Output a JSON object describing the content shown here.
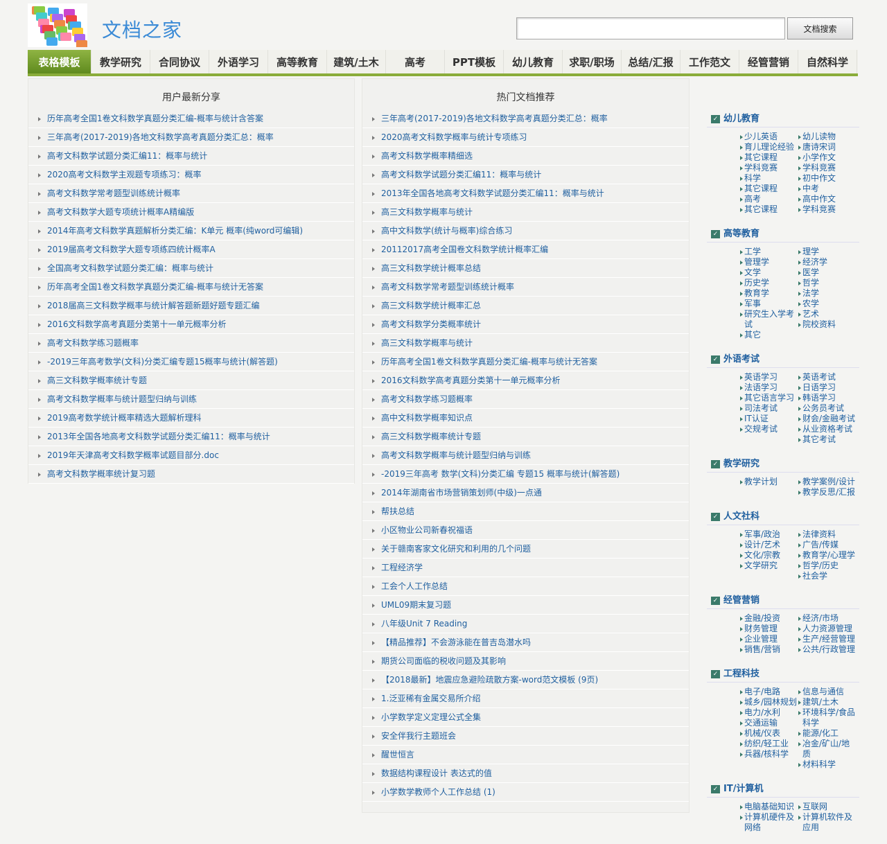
{
  "header": {
    "site_title": "文档之家",
    "search_placeholder": "",
    "search_button": "文档搜索"
  },
  "nav": [
    "表格模板",
    "教学研究",
    "合同协议",
    "外语学习",
    "高等教育",
    "建筑/土木",
    "高考",
    "PPT模板",
    "幼儿教育",
    "求职/职场",
    "总结/汇报",
    "工作范文",
    "经管营销",
    "自然科学"
  ],
  "latest": {
    "title": "用户最新分享",
    "items": [
      "历年高考全国1卷文科数学真题分类汇编-概率与统计含答案",
      "三年高考(2017-2019)各地文科数学高考真题分类汇总：概率",
      "高考文科数学试题分类汇编11：概率与统计",
      "2020高考文科数学主观题专项练习：概率",
      "高考文科数学常考题型训练统计概率",
      "高考文科数学大题专项统计概率A精编版",
      "2014年高考文科数学真题解析分类汇编：K单元 概率(纯word可编辑)",
      "2019届高考文科数学大题专项练四统计概率A",
      "全国高考文科数学试题分类汇编：概率与统计",
      "历年高考全国1卷文科数学真题分类汇编-概率与统计无答案",
      "2018届高三文科数学概率与统计解答题新题好题专题汇编",
      "2016文科数学高考真题分类第十一单元概率分析",
      "高考文科数学练习题概率",
      "-2019三年高考数学(文科)分类汇编专题15概率与统计(解答题)",
      "高三文科数学概率统计专题",
      "高考文科数学概率与统计题型归纳与训练",
      "2019高考数学统计概率精选大题解析理科",
      "2013年全国各地高考文科数学试题分类汇编11：概率与统计",
      "2019年天津高考文科数学概率试题目部分.doc",
      "高考文科数学概率统计复习题"
    ]
  },
  "hot": {
    "title": "热门文档推荐",
    "items": [
      "三年高考(2017-2019)各地文科数学高考真题分类汇总：概率",
      "2020高考文科数学概率与统计专项练习",
      "高考文科数学概率精细选",
      "高考文科数学试题分类汇编11：概率与统计",
      "2013年全国各地高考文科数学试题分类汇编11：概率与统计",
      "高三文科数学概率与统计",
      "高中文科数学(统计与概率)综合练习",
      "20112017高考全国卷文科数学统计概率汇编",
      "高三文科数学统计概率总结",
      "高考文科数学常考题型训练统计概率",
      "高三文科数学统计概率汇总",
      "高考文科数学分类概率统计",
      "高三文科数学概率与统计",
      "历年高考全国1卷文科数学真题分类汇编-概率与统计无答案",
      "2016文科数学高考真题分类第十一单元概率分析",
      "高考文科数学练习题概率",
      "高中文科数学概率知识点",
      "高三文科数学概率统计专题",
      "高考文科数学概率与统计题型归纳与训练",
      "-2019三年高考 数学(文科)分类汇编 专题15 概率与统计(解答题)",
      "2014年湖南省市场营销策划师(中级)一点通",
      "帮扶总结",
      "小区物业公司新春祝福语",
      "关于赣南客家文化研究和利用的几个问题",
      "工程经济学",
      "工会个人工作总结",
      "UML09期末复习题",
      "八年级Unit 7 Reading",
      "【精品推荐】不会游泳能在普吉岛潜水吗",
      "期货公司面临的税收问题及其影响",
      "【2018最新】地震应急避险疏散方案-word范文模板 (9页)",
      "1.泛亚稀有金属交易所介绍",
      "小学数学定义定理公式全集",
      "安全伴我行主题班会",
      "醒世恒言",
      "数据结构课程设计 表达式的值",
      "小学数学教师个人工作总结 (1)"
    ]
  },
  "sidebar": [
    {
      "title": "幼儿教育",
      "left": [
        "少儿英语",
        "育儿理论经验",
        "其它课程",
        "学科竞赛",
        "科学",
        "其它课程",
        "高考",
        "其它课程"
      ],
      "right": [
        "幼儿读物",
        "唐诗宋词",
        "小学作文",
        "学科竞赛",
        "初中作文",
        "中考",
        "高中作文",
        "学科竞赛"
      ]
    },
    {
      "title": "高等教育",
      "left": [
        "工学",
        "管理学",
        "文学",
        "历史学",
        "教育学",
        "军事",
        "研究生入学考试",
        "其它"
      ],
      "right": [
        "理学",
        "经济学",
        "医学",
        "哲学",
        "法学",
        "农学",
        "艺术",
        "院校资料"
      ]
    },
    {
      "title": "外语考试",
      "left": [
        "英语学习",
        "法语学习",
        "其它语言学习",
        "司法考试",
        "IT认证",
        "交规考试"
      ],
      "right": [
        "英语考试",
        "日语学习",
        "韩语学习",
        "公务员考试",
        "财会/金融考试",
        "从业资格考试",
        "其它考试"
      ]
    },
    {
      "title": "教学研究",
      "left": [
        "教学计划"
      ],
      "right": [
        "教学案例/设计",
        "教学反思/汇报"
      ]
    },
    {
      "title": "人文社科",
      "left": [
        "军事/政治",
        "设计/艺术",
        "文化/宗教",
        "文学研究"
      ],
      "right": [
        "法律资料",
        "广告/传媒",
        "教育学/心理学",
        "哲学/历史",
        "社会学"
      ]
    },
    {
      "title": "经管营销",
      "left": [
        "金融/投资",
        "财务管理",
        "企业管理",
        "销售/营销"
      ],
      "right": [
        "经济/市场",
        "人力资源管理",
        "生产/经营管理",
        "公共/行政管理"
      ]
    },
    {
      "title": "工程科技",
      "left": [
        "电子/电路",
        "城乡/园林规划",
        "电力/水利",
        "交通运输",
        "机械/仪表",
        "纺织/轻工业",
        "兵器/核科学"
      ],
      "right": [
        "信息与通信",
        "建筑/土木",
        "环境科学/食品科学",
        "能源/化工",
        "冶金/矿山/地质",
        "材料科学"
      ]
    },
    {
      "title": "IT/计算机",
      "left": [
        "电脑基础知识",
        "计算机硬件及网络"
      ],
      "right": [
        "互联网",
        "计算机软件及应用"
      ]
    }
  ]
}
